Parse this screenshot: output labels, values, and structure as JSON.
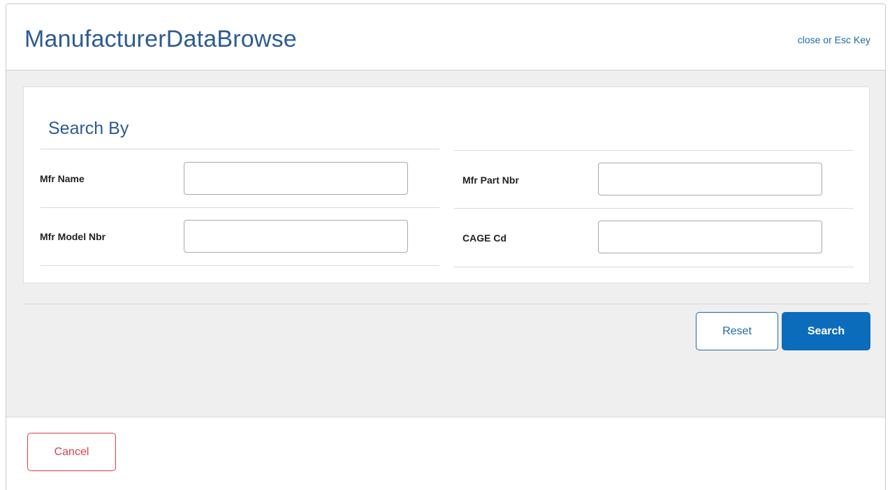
{
  "dialog": {
    "title": "ManufacturerDataBrowse",
    "close_link": "close or Esc Key"
  },
  "search_panel": {
    "title": "Search By",
    "fields": [
      {
        "label": "Mfr Name",
        "value": "",
        "placeholder": ""
      },
      {
        "label": "Mfr Part Nbr",
        "value": "",
        "placeholder": ""
      },
      {
        "label": "Mfr Model Nbr",
        "value": "",
        "placeholder": ""
      },
      {
        "label": "CAGE Cd",
        "value": "",
        "placeholder": ""
      }
    ]
  },
  "actions": {
    "reset_label": "Reset",
    "search_label": "Search"
  },
  "footer": {
    "cancel_label": "Cancel"
  },
  "colors": {
    "title": "#2d5b93",
    "link": "#1c6aa8",
    "primary": "#0b6cbb",
    "danger": "#e03c4b",
    "body_bg": "#efefef"
  }
}
